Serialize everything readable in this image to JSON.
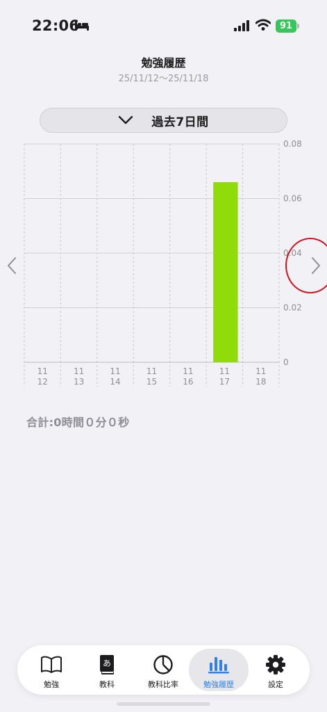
{
  "status_bar": {
    "time": "22:06",
    "battery": "91",
    "icons": [
      "bed-icon",
      "signal-icon",
      "wifi-icon",
      "battery-icon"
    ]
  },
  "header": {
    "title": "勉強履歴",
    "date_range": "25/11/12〜25/11/18"
  },
  "period_selector": {
    "label": "過去7日間",
    "icon": "chevron-down-icon"
  },
  "chart_data": {
    "type": "bar",
    "categories": [
      "11\n12",
      "11\n13",
      "11\n14",
      "11\n15",
      "11\n16",
      "11\n17",
      "11\n18"
    ],
    "category_lines": [
      [
        "11",
        "12"
      ],
      [
        "11",
        "13"
      ],
      [
        "11",
        "14"
      ],
      [
        "11",
        "15"
      ],
      [
        "11",
        "16"
      ],
      [
        "11",
        "17"
      ],
      [
        "11",
        "18"
      ]
    ],
    "values": [
      0,
      0,
      0,
      0,
      0,
      0.066,
      0
    ],
    "ylim": [
      0,
      0.08
    ],
    "y_ticks": [
      "0",
      "0.02",
      "0.04",
      "0.06",
      "0.08"
    ],
    "y_tick_values": [
      0,
      0.02,
      0.04,
      0.06,
      0.08
    ],
    "bar_color": "#8fdc0a",
    "y_axis_position": "right",
    "grid": true
  },
  "summary": {
    "total": "合計:0時間０分０秒"
  },
  "tabs": [
    {
      "label": "勉強",
      "icon": "book-icon",
      "active": false
    },
    {
      "label": "教科",
      "icon": "subject-book-icon",
      "active": false
    },
    {
      "label": "教科比率",
      "icon": "pie-chart-icon",
      "active": false
    },
    {
      "label": "勉強履歴",
      "icon": "bar-chart-icon",
      "active": true
    },
    {
      "label": "設定",
      "icon": "gear-icon",
      "active": false
    }
  ],
  "colors": {
    "accent": "#2f80ed",
    "bar": "#8fdc0a",
    "battery": "#34c759",
    "highlight": "#d0121b"
  }
}
